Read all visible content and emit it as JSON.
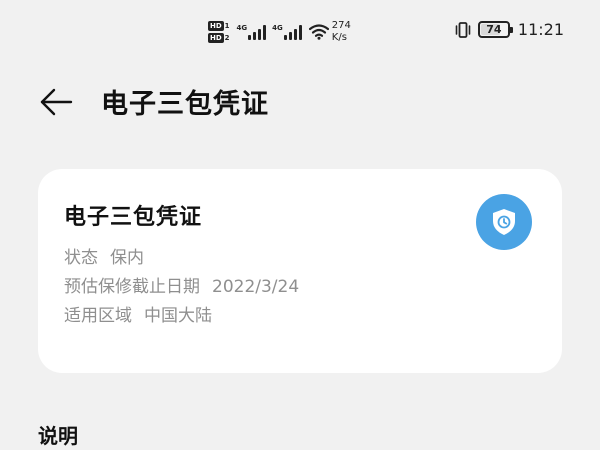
{
  "status_bar": {
    "sim1_badge": "HD",
    "sim1_num": "1",
    "sim2_badge": "HD",
    "sim2_num": "2",
    "net1": "4G",
    "net2": "4G",
    "speed_value": "274",
    "speed_unit": "K/s",
    "battery_level": "74",
    "battery_percent": 74,
    "time": "11:21",
    "icons": [
      "wifi-icon",
      "vibrate-icon"
    ]
  },
  "header": {
    "back_icon": "arrow-left-icon",
    "title": "电子三包凭证"
  },
  "card": {
    "title": "电子三包凭证",
    "status_label": "状态",
    "status_value": "保内",
    "expiry_label": "预估保修截止日期",
    "expiry_value": "2022/3/24",
    "region_label": "适用区域",
    "region_value": "中国大陆",
    "badge_icon": "shield-clock-icon",
    "badge_color": "#4aa3e4"
  },
  "section": {
    "title": "说明"
  }
}
